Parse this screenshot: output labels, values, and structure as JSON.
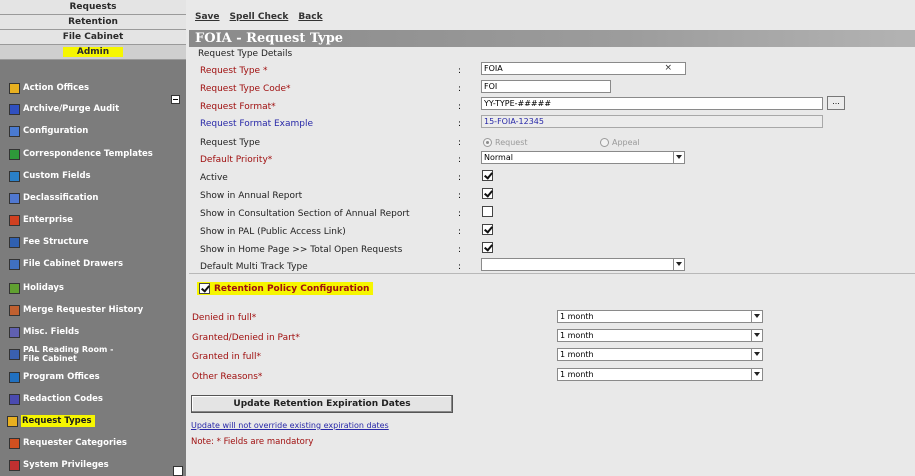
{
  "top_nav": [
    "Requests",
    "Retention",
    "File Cabinet",
    "Admin"
  ],
  "sidebar": {
    "items": [
      {
        "label": "Action Offices",
        "icon": "action-offices-icon",
        "color": "#e8b020"
      },
      {
        "label": "Archive/Purge Audit",
        "icon": "archive-icon",
        "color": "#3050c0"
      },
      {
        "label": "Configuration",
        "icon": "configuration-icon",
        "color": "#4a7ad0"
      },
      {
        "label": "Correspondence Templates",
        "icon": "templates-icon",
        "color": "#2e9a3a"
      },
      {
        "label": "Custom Fields",
        "icon": "custom-fields-icon",
        "color": "#2a80c8"
      },
      {
        "label": "Declassification",
        "icon": "declassification-icon",
        "color": "#5078d0"
      },
      {
        "label": "Enterprise",
        "icon": "enterprise-icon",
        "color": "#d04020"
      },
      {
        "label": "Fee Structure",
        "icon": "fee-structure-icon",
        "color": "#3060b0"
      },
      {
        "label": "File Cabinet Drawers",
        "icon": "file-cabinet-icon",
        "color": "#4070c0"
      },
      {
        "label": "Holidays",
        "icon": "holidays-icon",
        "color": "#60a030"
      },
      {
        "label": "Merge Requester History",
        "icon": "merge-icon",
        "color": "#c06030"
      },
      {
        "label": "Misc. Fields",
        "icon": "misc-fields-icon",
        "color": "#6060b0"
      },
      {
        "label": "PAL Reading Room - File Cabinet",
        "icon": "pal-icon",
        "color": "#3a60b0"
      },
      {
        "label": "Program Offices",
        "icon": "program-offices-icon",
        "color": "#2070c0"
      },
      {
        "label": "Redaction Codes",
        "icon": "redaction-icon",
        "color": "#4a4ab0"
      },
      {
        "label": "Request Types",
        "icon": "request-types-icon",
        "color": "#e8b020"
      },
      {
        "label": "Requester Categories",
        "icon": "requester-categories-icon",
        "color": "#d05020"
      },
      {
        "label": "System Privileges",
        "icon": "system-privileges-icon",
        "color": "#c03030"
      }
    ]
  },
  "toolbar": {
    "save": "Save",
    "spell_check": "Spell Check",
    "back": "Back"
  },
  "page_title": "FOIA - Request Type",
  "section_title": "Request Type Details",
  "form": {
    "request_type": {
      "label": "Request Type *",
      "value": "FOIA",
      "clear": "×"
    },
    "request_type_code": {
      "label": "Request Type Code*",
      "value": "FOI"
    },
    "request_format": {
      "label": "Request Format*",
      "value": "YY-TYPE-#####",
      "button": "..."
    },
    "request_format_example": {
      "label": "Request Format Example",
      "value": "15-FOIA-12345"
    },
    "request_type_kind": {
      "label": "Request Type",
      "opt1": "Request",
      "opt2": "Appeal"
    },
    "default_priority": {
      "label": "Default Priority*",
      "value": "Normal"
    },
    "active": {
      "label": "Active"
    },
    "show_annual_report": {
      "label": "Show in Annual Report"
    },
    "show_consultation": {
      "label": "Show in Consultation Section of Annual Report"
    },
    "show_pal": {
      "label": "Show in PAL (Public Access Link)"
    },
    "show_home_page": {
      "label": "Show in Home Page >> Total Open Requests"
    },
    "default_multi_track": {
      "label": "Default Multi Track Type",
      "value": ""
    },
    "colon": ":"
  },
  "retention": {
    "config_label": "Retention Policy Configuration",
    "rows": [
      {
        "label": "Denied in full*",
        "value": "1 month"
      },
      {
        "label": "Granted/Denied in Part*",
        "value": "1 month"
      },
      {
        "label": "Granted in full*",
        "value": "1 month"
      },
      {
        "label": "Other Reasons*",
        "value": "1 month"
      }
    ],
    "update_button": "Update Retention Expiration Dates",
    "update_note": "Update will not override existing expiration dates",
    "mandatory_note": "Note: * Fields are mandatory"
  }
}
